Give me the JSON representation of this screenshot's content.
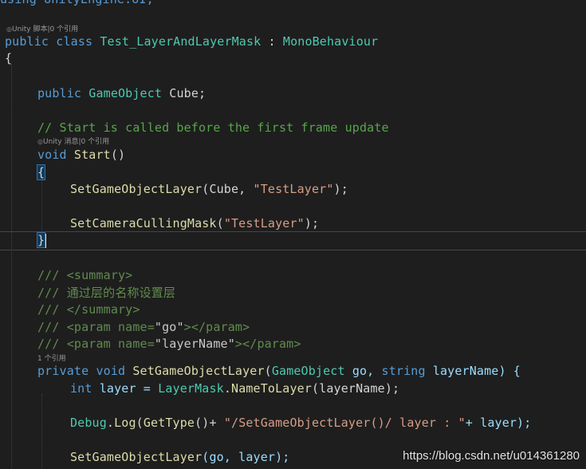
{
  "lens": {
    "class_refs": "Unity 脚本|0 个引用",
    "start_refs": "Unity 消息|0 个引用",
    "method_refs": "1 个引用"
  },
  "code": {
    "l0": "using UnityEngine.UI;",
    "class_kw1": "public",
    "class_kw2": "class",
    "class_name": "Test_LayerAndLayerMask",
    "class_colon": " : ",
    "class_base": "MonoBehaviour",
    "open_brace": "{",
    "field_kw": "public",
    "field_type": "GameObject",
    "field_name": " Cube;",
    "comment_start": "// Start is called before the first frame update",
    "start_kw": "void",
    "start_name": "Start",
    "start_parens": "()",
    "start_open": "{",
    "call1_name": "SetGameObjectLayer",
    "call1_open": "(Cube, ",
    "call1_str": "\"TestLayer\"",
    "call1_close": ");",
    "call2_name": "SetCameraCullingMask",
    "call2_open": "(",
    "call2_str": "\"TestLayer\"",
    "call2_close": ");",
    "start_close": "}",
    "doc1_slash": "/// ",
    "doc1_tag": "<summary>",
    "doc2_slash": "/// ",
    "doc2_text": "通过层的名称设置层",
    "doc3_slash": "/// ",
    "doc3_tag": "</summary>",
    "doc4_slash": "/// ",
    "doc4_tag_open": "<param name=",
    "doc4_q": "\"go\"",
    "doc4_tag_close": "></param>",
    "doc5_slash": "/// ",
    "doc5_tag_open": "<param name=",
    "doc5_q": "\"layerName\"",
    "doc5_tag_close": "></param>",
    "m_kw1": "private",
    "m_kw2": "void",
    "m_name": "SetGameObjectLayer",
    "m_p1": "(",
    "m_type1": "GameObject",
    "m_arg1": " go, ",
    "m_type2": "string",
    "m_arg2": " layerName) {",
    "l_kw": "int",
    "l_var": " layer = ",
    "l_type": "LayerMask",
    "l_dot": ".",
    "l_fn": "NameToLayer",
    "l_rest": "(layerName);",
    "dbg_type": "Debug",
    "dbg_dot": ".",
    "dbg_fn": "Log",
    "dbg_p": "(",
    "dbg_fn2": "GetType",
    "dbg_p2": "()+ ",
    "dbg_str": "\"/SetGameObjectLayer()/ layer : \"",
    "dbg_rest": "+ layer);",
    "last_name": "SetGameObjectLayer",
    "last_rest": "(go, layer);"
  },
  "watermark": "https://blog.csdn.net/u014361280"
}
